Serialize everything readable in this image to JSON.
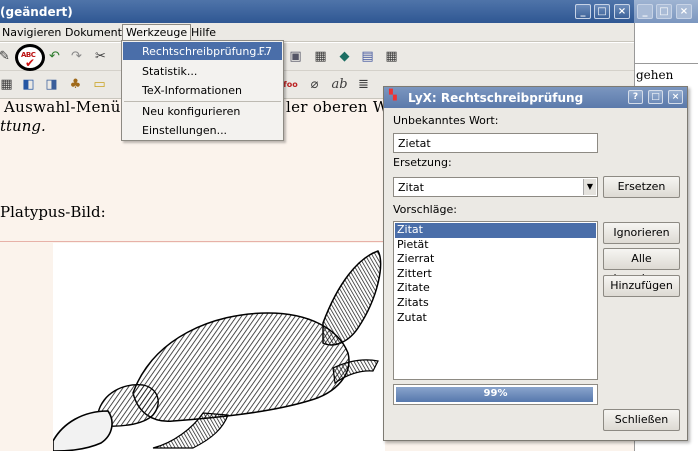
{
  "window": {
    "title": "(geändert)",
    "menus": {
      "navigieren": "Navigieren",
      "dokument": "Dokument",
      "werkzeuge": "Werkzeuge",
      "hilfe": "Hilfe"
    }
  },
  "tools_menu": {
    "items": [
      {
        "label": "Rechtschreibprüfung...",
        "shortcut": "F7"
      },
      {
        "label": "Statistik..."
      },
      {
        "label": "TeX-Informationen"
      },
      {
        "label": "Neu konfigurieren"
      },
      {
        "label": "Einstellungen..."
      }
    ]
  },
  "document": {
    "line1a": "Auswahl-Menü a",
    "line1b": "ler oberen W",
    "line2": "ttung.",
    "line3": "Platypus-Bild:"
  },
  "background_window": {
    "text": "gehen"
  },
  "spellcheck": {
    "title": "LyX: Rechtschreibprüfung",
    "unknown_label": "Unbekanntes Wort:",
    "unknown_value": "Zietat",
    "replacement_label": "Ersetzung:",
    "replacement_value": "Zitat",
    "replace_button": "Ersetzen",
    "suggestions_label": "Vorschläge:",
    "suggestions": [
      "Zitat",
      "Pietät",
      "Zierrat",
      "Zittert",
      "Zitate",
      "Zitats",
      "Zutat"
    ],
    "ignore_button": "Ignorieren",
    "ignore_all_button": "Alle ignorieren",
    "add_button": "Hinzufügen",
    "progress_text": "99%",
    "progress_value": 0.99,
    "close_button": "Schließen"
  },
  "colors": {
    "titlebar": "#3a629c",
    "selection": "#4a6ea9",
    "document_bg": "#fbf3ec"
  }
}
